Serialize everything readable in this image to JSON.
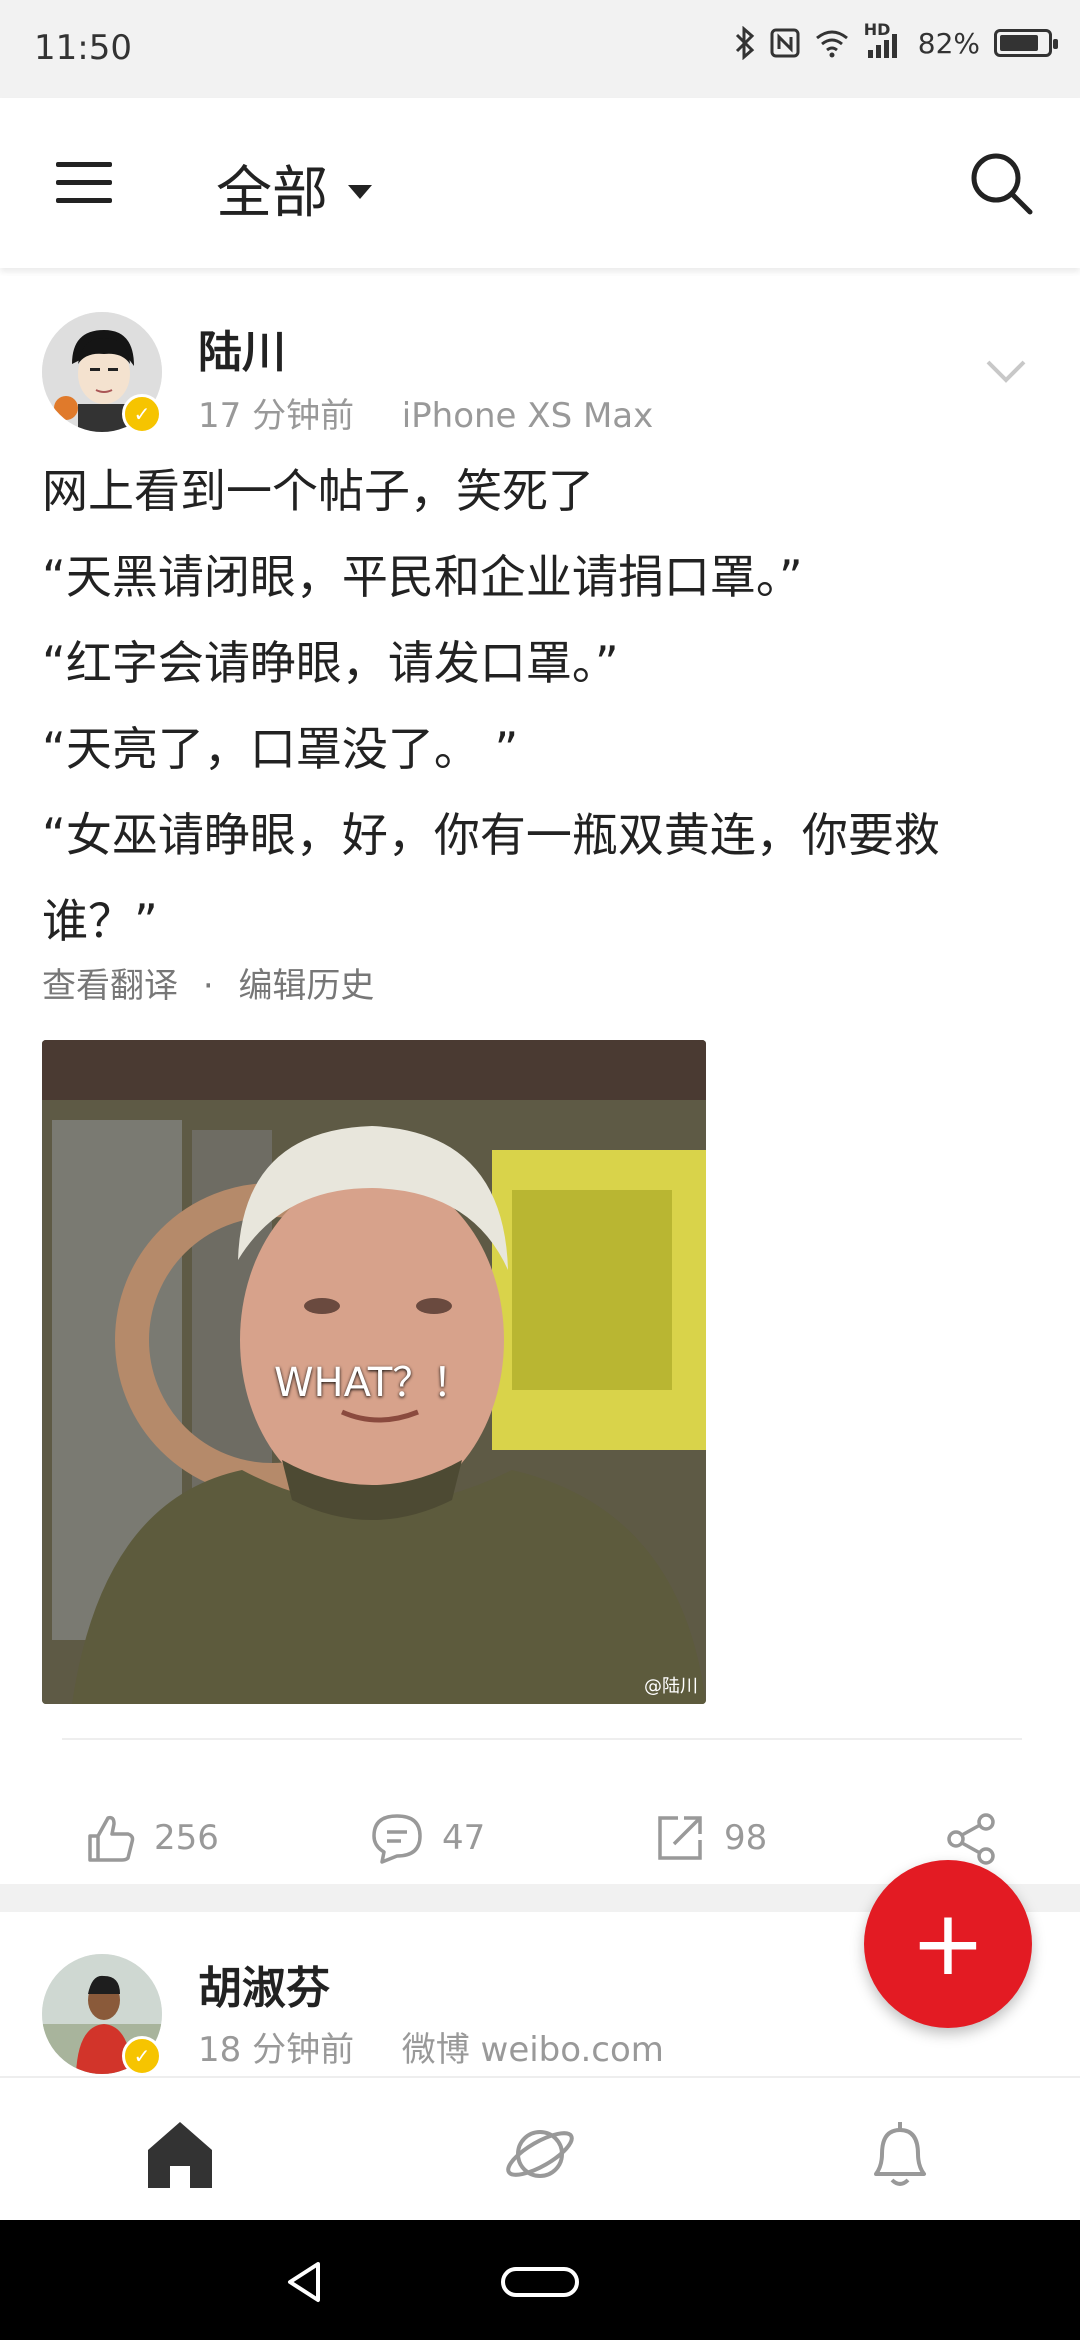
{
  "status_bar": {
    "time": "11:50",
    "network": "HD",
    "battery": "82%",
    "battery_level": 0.82,
    "icons": [
      "bluetooth-icon",
      "nfc-icon",
      "wifi-icon",
      "signal-icon",
      "battery-icon"
    ]
  },
  "header": {
    "title": "全部",
    "icons": [
      "menu-icon",
      "dropdown-triangle-icon",
      "search-icon"
    ]
  },
  "post": {
    "author": "陆川",
    "time": "17 分钟前",
    "source": "iPhone XS Max",
    "lines": [
      "网上看到一个帖子，笑死了",
      "“天黑请闭眼，平民和企业请捐口罩。”",
      "“红字会请睁眼，请发口罩。”",
      "“天亮了，口罩没了。 ”",
      "“女巫请睁眼，好，你有一瓶双黄连，你要救",
      "谁？”"
    ],
    "translate_link": "查看翻译",
    "separator": "·",
    "edit_history_link": "编辑历史",
    "image_caption": "WHAT？！",
    "image_watermark": "@陆川",
    "actions": {
      "likes": "256",
      "comments": "47",
      "reposts": "98"
    }
  },
  "next_post": {
    "author": "胡淑芬",
    "time": "18 分钟前",
    "source": "微博 weibo.com"
  },
  "fab": {
    "label": "+"
  },
  "tab_bar": {
    "tabs": [
      "home-icon",
      "discover-planet-icon",
      "notifications-bell-icon"
    ]
  },
  "colors": {
    "accent": "#e31b23",
    "verified": "#f6c400",
    "muted_text": "#999999"
  }
}
